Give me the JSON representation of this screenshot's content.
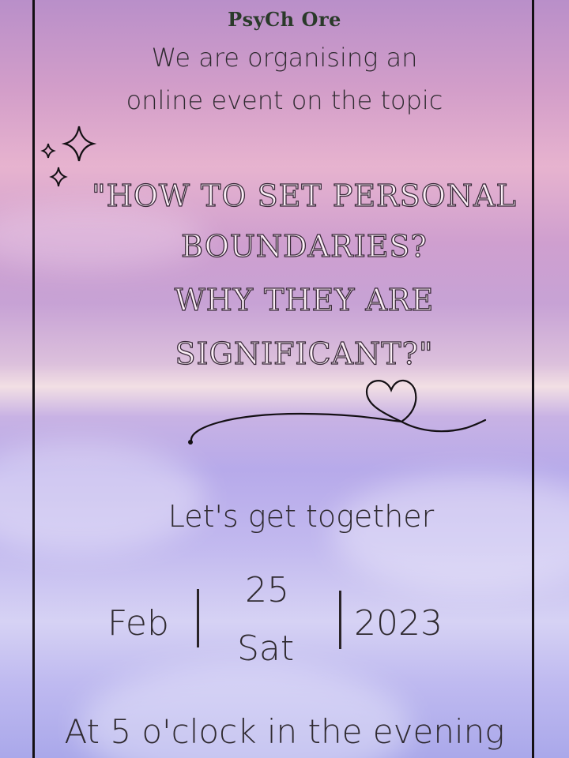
{
  "brand": "PsyCh Ore",
  "intro": {
    "line1": "We are organising an",
    "line2": "online event on the topic"
  },
  "topic": {
    "line1": "\"HOW TO SET PERSONAL",
    "line2": "BOUNDARIES?",
    "line3": "WHY THEY ARE",
    "line4": "SIGNIFICANT?\""
  },
  "tagline": "Let's get together",
  "date": {
    "month": "Feb",
    "day": "25",
    "weekday": "Sat",
    "year": "2023"
  },
  "time": "At 5 o'clock in the evening",
  "icons": [
    "sparkle-icon",
    "heart-doodle-icon"
  ],
  "colors": {
    "frame": "#141014",
    "text": "#2f2a30",
    "title_outline": "#3a2a3a"
  }
}
